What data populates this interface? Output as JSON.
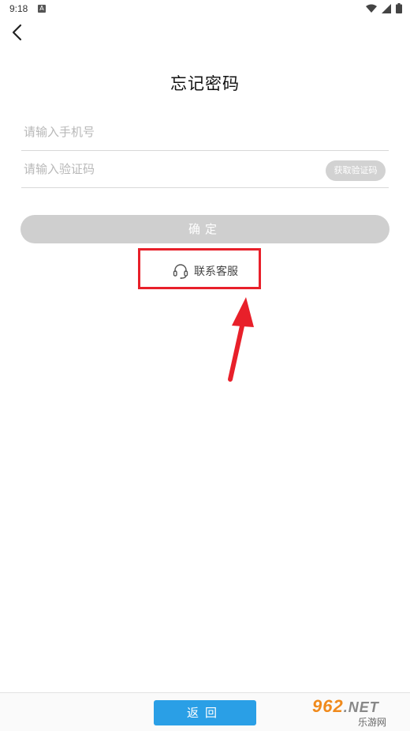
{
  "status_bar": {
    "time": "9:18",
    "notification_letter": "A",
    "icons": [
      "wifi-icon",
      "cellular-icon",
      "battery-icon"
    ]
  },
  "header": {
    "back_icon": "chevron-left-icon",
    "title": "忘记密码"
  },
  "form": {
    "phone_placeholder": "请输入手机号",
    "phone_value": "",
    "code_placeholder": "请输入验证码",
    "code_value": "",
    "get_code_label": "获取验证码",
    "confirm_label": "确定"
  },
  "contact": {
    "icon": "headset-icon",
    "label": "联系客服",
    "highlight_color": "#e8202a"
  },
  "footer": {
    "return_label": "返回",
    "watermark_top": "962",
    "watermark_net": ".NET",
    "watermark_bottom": "乐游网"
  },
  "colors": {
    "accent_blue": "#2a9fe6",
    "disabled_gray": "#cfcfcf",
    "annotation_red": "#e8202a"
  }
}
